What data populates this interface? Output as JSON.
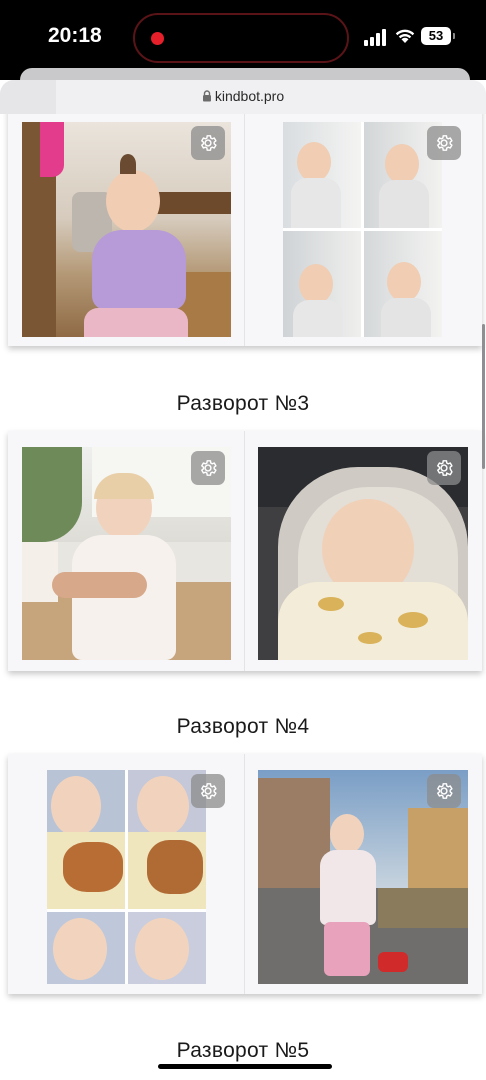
{
  "status_bar": {
    "time": "20:18",
    "battery": "53",
    "recording_color": "#e5202b"
  },
  "browser": {
    "url": "kindbot.pro",
    "lock_icon": "lock-icon"
  },
  "spreads": [
    {
      "id": "spread-2",
      "title": "",
      "pages": [
        {
          "photo": "baby-sitting-purple-sweater",
          "layout": "single"
        },
        {
          "photo": "baby-window-collage",
          "layout": "grid-2x2"
        }
      ]
    },
    {
      "id": "spread-3",
      "title": "Разворот №3",
      "pages": [
        {
          "photo": "baby-standing-white-dress",
          "layout": "single"
        },
        {
          "photo": "baby-in-car-seat",
          "layout": "single"
        }
      ]
    },
    {
      "id": "spread-4",
      "title": "Разворот №4",
      "pages": [
        {
          "photo": "baby-with-cat-collage",
          "layout": "grid-2x2"
        },
        {
          "photo": "toddler-outdoors-pink-vest",
          "layout": "single"
        }
      ]
    },
    {
      "id": "spread-5",
      "title": "Разворот №5",
      "pages": []
    }
  ],
  "icons": {
    "settings": "gear-icon"
  }
}
